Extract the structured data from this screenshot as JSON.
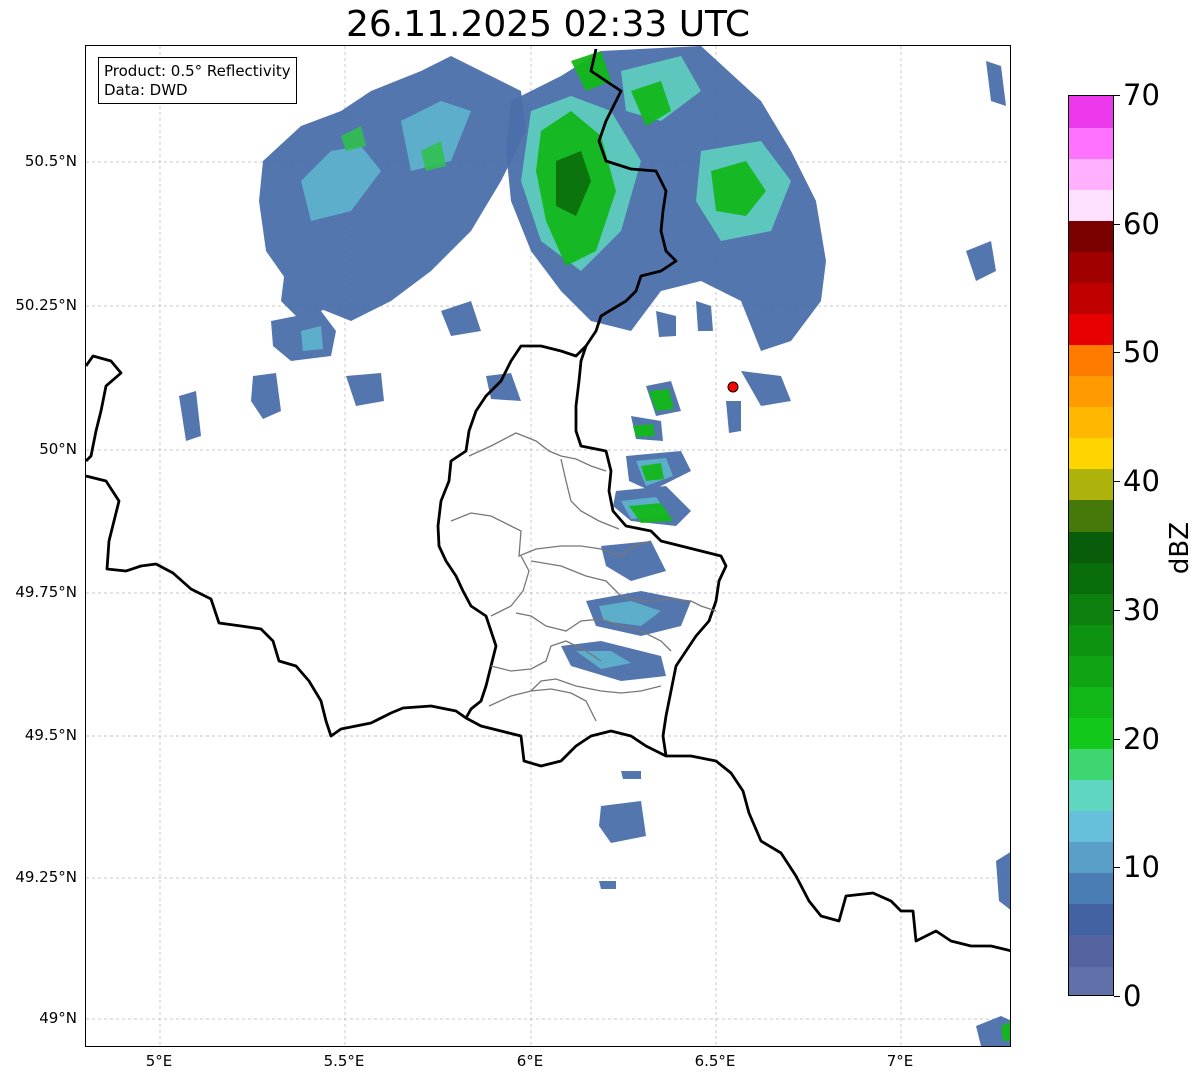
{
  "title": "26.11.2025 02:33 UTC",
  "info": {
    "product": "Product: 0.5° Reflectivity",
    "source": "Data: DWD"
  },
  "lat_labels": [
    "50.5°N",
    "50.25°N",
    "50°N",
    "49.75°N",
    "49.5°N",
    "49.25°N",
    "49°N"
  ],
  "lon_labels": [
    "5°E",
    "5.5°E",
    "6°E",
    "6.5°E",
    "7°E"
  ],
  "colorbar": {
    "label": "dBZ",
    "tick_labels": [
      "0",
      "10",
      "20",
      "30",
      "40",
      "50",
      "60",
      "70"
    ],
    "colors": [
      "#6070a8",
      "#5464a0",
      "#4262a2",
      "#4b7db5",
      "#5a9fc7",
      "#66c0dc",
      "#5fd6c0",
      "#3dd670",
      "#12c81a",
      "#11b617",
      "#10a414",
      "#0e9211",
      "#0c7f0e",
      "#0a6d0b",
      "#095c09",
      "#457a0b",
      "#adb30a",
      "#ffd500",
      "#ffb700",
      "#ff9a00",
      "#ff7b00",
      "#e60000",
      "#c00000",
      "#a00000",
      "#7b0000",
      "#ffe0ff",
      "#ffb0ff",
      "#ff72ff",
      "#ea38ea"
    ]
  },
  "station_marker": {
    "lat": 50.11,
    "lon": 6.55,
    "color": "#ff0000"
  }
}
